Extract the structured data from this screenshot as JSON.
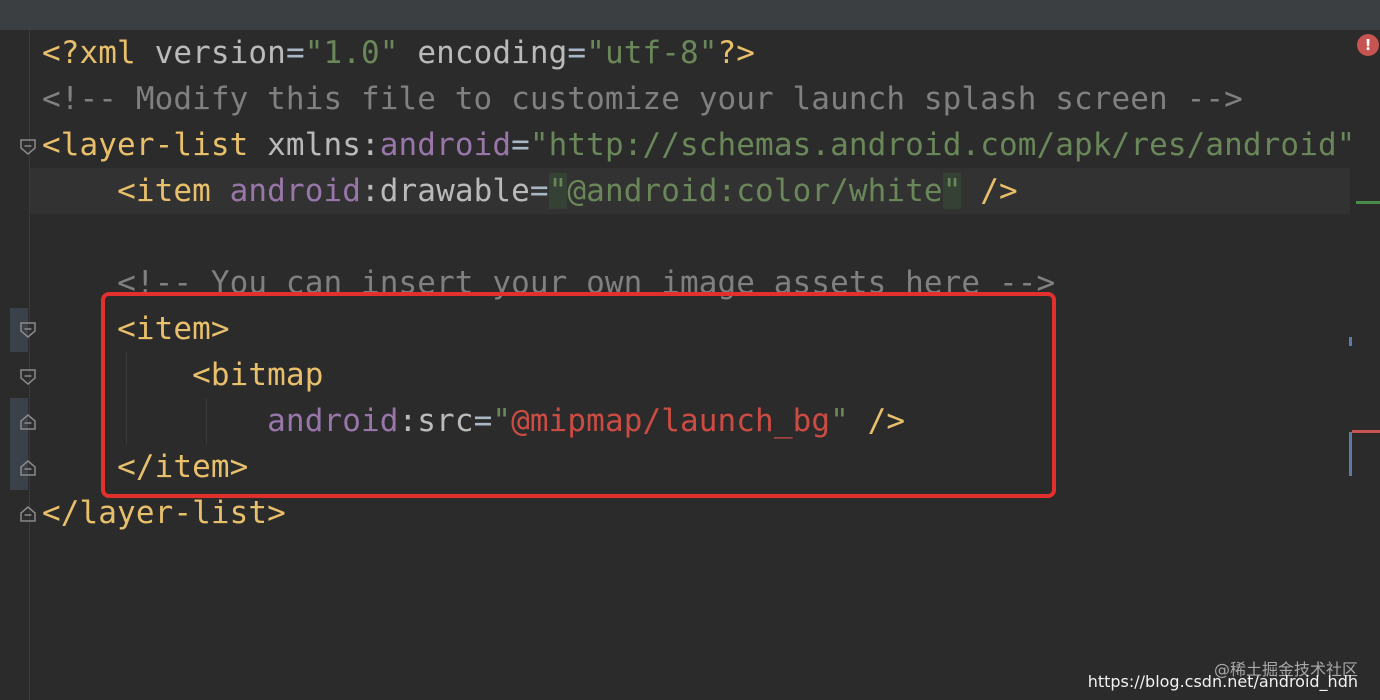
{
  "editor": {
    "lines": {
      "l1": {
        "open": "<?",
        "name": "xml",
        "a1": "version",
        "eq1": "=",
        "v1": "\"1.0\"",
        "a2": "encoding",
        "eq2": "=",
        "v2": "\"utf-8\"",
        "close": "?>"
      },
      "l2": {
        "comment": "<!-- Modify this file to customize your launch splash screen -->"
      },
      "l3": {
        "open": "<layer-list",
        "a1": "xmlns",
        "colon": ":",
        "ns": "android",
        "eq": "=",
        "val": "\"http://schemas.android.com/apk/res/android\""
      },
      "l4": {
        "open": "<item",
        "ns": "android",
        "colon": ":",
        "attr": "drawable",
        "eq": "=",
        "q1": "\"",
        "val": "@android:color/white",
        "q2": "\"",
        "close": "/>"
      },
      "l6": {
        "comment": "<!-- You can insert your own image assets here -->"
      },
      "l7": {
        "tag": "<item>"
      },
      "l8": {
        "tag": "<bitmap"
      },
      "l9": {
        "ns": "android",
        "colon": ":",
        "attr": "src",
        "eq": "=",
        "q1": "\"",
        "val": "@mipmap/launch_bg",
        "q2": "\"",
        "close": "/>"
      },
      "l10": {
        "tag": "</item>"
      },
      "l11": {
        "tag": "</layer-list>"
      }
    }
  },
  "status": {
    "error_mark": "!"
  },
  "watermark": {
    "line1": "@稀土掘金技术社区",
    "line2": "https://blog.csdn.net/android_hdh"
  },
  "colors": {
    "background": "#2b2b2b",
    "tag": "#e8bf6a",
    "attribute": "#bababa",
    "namespace": "#9876aa",
    "string": "#6a8759",
    "resource_reference": "#cc4c44",
    "comment": "#808080",
    "highlight_box": "#e2312d"
  }
}
